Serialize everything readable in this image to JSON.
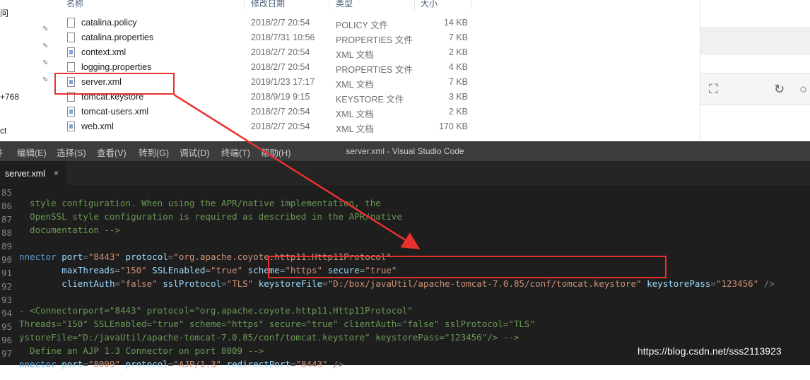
{
  "explorer": {
    "nav_fragments": [
      "问",
      "+768",
      "ct"
    ],
    "columns": {
      "name": "名称",
      "modified": "修改日期",
      "type": "类型",
      "size": "大小"
    },
    "files": [
      {
        "name": "catalina.policy",
        "date": "2018/2/7 20:54",
        "type": "POLICY 文件",
        "size": "14 KB",
        "icon": "file-icon"
      },
      {
        "name": "catalina.properties",
        "date": "2018/7/31 10:56",
        "type": "PROPERTIES 文件",
        "size": "7 KB",
        "icon": "file-icon"
      },
      {
        "name": "context.xml",
        "date": "2018/2/7 20:54",
        "type": "XML 文档",
        "size": "2 KB",
        "icon": "xml-file-icon"
      },
      {
        "name": "logging.properties",
        "date": "2018/2/7 20:54",
        "type": "PROPERTIES 文件",
        "size": "4 KB",
        "icon": "file-icon"
      },
      {
        "name": "server.xml",
        "date": "2019/1/23 17:17",
        "type": "XML 文档",
        "size": "7 KB",
        "icon": "xml-file-icon"
      },
      {
        "name": "tomcat.keystore",
        "date": "2018/9/19 9:15",
        "type": "KEYSTORE 文件",
        "size": "3 KB",
        "icon": "file-icon"
      },
      {
        "name": "tomcat-users.xml",
        "date": "2018/2/7 20:54",
        "type": "XML 文档",
        "size": "2 KB",
        "icon": "xml-file-icon"
      },
      {
        "name": "web.xml",
        "date": "2018/2/7 20:54",
        "type": "XML 文档",
        "size": "170 KB",
        "icon": "xml-file-icon"
      }
    ],
    "right_toolbar_icons": [
      "fullscreen-icon",
      "refresh-icon",
      "search-icon"
    ]
  },
  "vscode": {
    "menus": [
      "件",
      "编辑(E)",
      "选择(S)",
      "查看(V)",
      "转到(G)",
      "调试(D)",
      "终端(T)",
      "帮助(H)"
    ],
    "window_title": "server.xml - Visual Studio Code",
    "tab": {
      "label": "server.xml",
      "close": "×"
    },
    "lines": [
      {
        "n": "85",
        "code": "  style configuration. When using the APR/native implementation, the"
      },
      {
        "n": "86",
        "code": "  OpenSSL style configuration is required as described in the APR/native"
      },
      {
        "n": "87",
        "code": "  documentation -->"
      },
      {
        "n": "88",
        "code": ""
      },
      {
        "n": "89",
        "code": "nnector port=\"8443\" protocol=\"org.apache.coyote.http11.Http11Protocol\""
      },
      {
        "n": "90",
        "code": "        maxThreads=\"150\" SSLEnabled=\"true\" scheme=\"https\" secure=\"true\""
      },
      {
        "n": "91",
        "code": "        clientAuth=\"false\" sslProtocol=\"TLS\" keystoreFile=\"D:/box/javaUtil/apache-tomcat-7.0.85/conf/tomcat.keystore\" keystorePass=\"123456\" />"
      },
      {
        "n": "92",
        "code": ""
      },
      {
        "n": "93",
        "code": "- <Connectorport=\"8443\" protocol=\"org.apache.coyote.http11.Http11Protocol\""
      },
      {
        "n": "94",
        "code": "Threads=\"150\" SSLEnabled=\"true\" scheme=\"https\" secure=\"true\" clientAuth=\"false\" sslProtocol=\"TLS\""
      },
      {
        "n": "95",
        "code": "ystoreFile=\"D:/javaUtil/apache-tomcat-7.0.85/conf/tomcat.keystore\" keystorePass=\"123456\"/> -->"
      },
      {
        "n": "96",
        "code": "  Define an AJP 1.3 Connector on port 8009 -->"
      },
      {
        "n": "97",
        "code": "nnector port=\"8009\" protocol=\"AJP/1.3\" redirectPort=\"8443\" />"
      }
    ]
  },
  "annotation": {
    "color": "#e8312e"
  },
  "watermark": "https://blog.csdn.net/sss2113923"
}
